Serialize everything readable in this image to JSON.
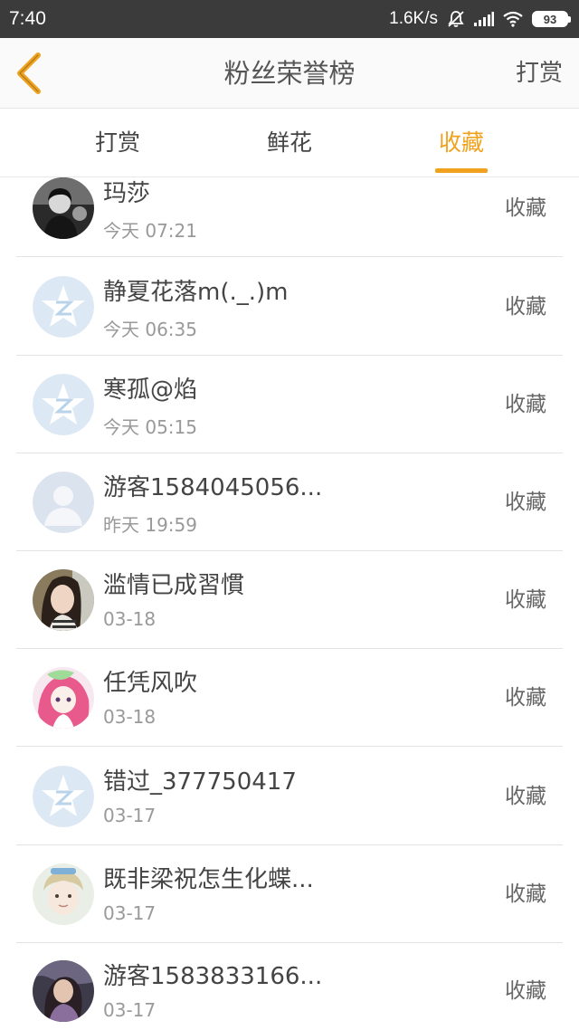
{
  "status_bar": {
    "time": "7:40",
    "network_speed": "1.6K/s",
    "battery": "93",
    "icons": [
      "mute-bell-icon",
      "signal-icon",
      "wifi-icon",
      "battery-icon"
    ]
  },
  "nav": {
    "back_icon": "chevron-left-icon",
    "title": "粉丝荣誉榜",
    "action_label": "打赏"
  },
  "tabs": [
    {
      "label": "打赏",
      "active": false
    },
    {
      "label": "鲜花",
      "active": false
    },
    {
      "label": "收藏",
      "active": true
    }
  ],
  "colors": {
    "accent": "#f0a21e",
    "status_bar_bg": "#3b3b3b",
    "default_avatar_bg": "#dce9f5",
    "default_avatar_fg": "#ffffff"
  },
  "list": [
    {
      "name": "玛莎",
      "time": "今天 07:21",
      "type": "收藏",
      "avatar": "photo-bw"
    },
    {
      "name": "静夏花落m(._.)m",
      "time": "今天 06:35",
      "type": "收藏",
      "avatar": "qzone-default"
    },
    {
      "name": "寒孤@焰",
      "time": "今天 05:15",
      "type": "收藏",
      "avatar": "qzone-default"
    },
    {
      "name": "游客1584045056...",
      "time": "昨天 19:59",
      "type": "收藏",
      "avatar": "person-placeholder"
    },
    {
      "name": "滥情已成習慣",
      "time": "03-18",
      "type": "收藏",
      "avatar": "photo-girl"
    },
    {
      "name": "任凭风吹",
      "time": "03-18",
      "type": "收藏",
      "avatar": "anime-girl"
    },
    {
      "name": "错过_377750417",
      "time": "03-17",
      "type": "收藏",
      "avatar": "qzone-default"
    },
    {
      "name": "既非梁祝怎生化蝶...",
      "time": "03-17",
      "type": "收藏",
      "avatar": "photo-selfie"
    },
    {
      "name": "游客1583833166...",
      "time": "03-17",
      "type": "收藏",
      "avatar": "photo-dark"
    }
  ]
}
